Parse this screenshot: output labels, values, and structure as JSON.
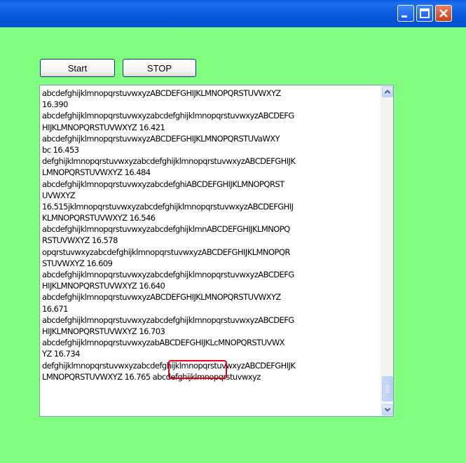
{
  "window": {
    "title_buttons": [
      "minimize-icon",
      "maximize-icon",
      "close-icon"
    ]
  },
  "toolbar": {
    "start_label": "Start",
    "stop_label": "STOP"
  },
  "log": {
    "lines": [
      "abcdefghijklmnopqrstuvwxyzABCDEFGHIJKLMNOPQRSTUVWXYZ",
      "16.390",
      "abcdefghijklmnopqrstuvwxyzabcdefghijklmnopqrstuvwxyzABCDEFG",
      "HIJKLMNOPQRSTUVWXYZ 16.421",
      "abcdefghijklmnopqrstuvwxyzABCDEFGHIJKLMNOPQRSTUVaWXY",
      "bc 16.453",
      "defghijklmnopqrstuvwxyzabcdefghijklmnopqrstuvwxyzABCDEFGHIJK",
      "LMNOPQRSTUVWXYZ 16.484",
      "abcdefghijklmnopqrstuvwxyzabcdefghiABCDEFGHIJKLMNOPQRST",
      "UVWXYZ",
      "16.515jklmnopqrstuvwxyzabcdefghijklmnopqrstuvwxyzABCDEFGHIJ",
      "KLMNOPQRSTUVWXYZ 16.546",
      "abcdefghijklmnopqrstuvwxyzabcdefghijklmnABCDEFGHIJKLMNOPQ",
      "RSTUVWXYZ 16.578",
      "opqrstuvwxyzabcdefghijklmnopqrstuvwxyzABCDEFGHIJKLMNOPQR",
      "STUVWXYZ 16.609",
      "abcdefghijklmnopqrstuvwxyzabcdefghijklmnopqrstuvwxyzABCDEFG",
      "HIJKLMNOPQRSTUVWXYZ 16.640",
      "abcdefghijklmnopqrstuvwxyzABCDEFGHIJKLMNOPQRSTUVWXYZ",
      "16.671",
      "abcdefghijklmnopqrstuvwxyzabcdefghijklmnopqrstuvwxyzABCDEFG",
      "HIJKLMNOPQRSTUVWXYZ 16.703",
      "abcdefghijklmnopqrstuvwxyzabABCDEFGHIJKLcMNOPQRSTUVWX",
      "YZ 16.734",
      "defghijklmnopqrstuvwxyzabcdefghijklmnopqrstuvwxyzABCDEFGHIJK",
      "LMNOPQRSTUVWXYZ 16.765 abcdefghijklmnopqrstuvwxyz"
    ]
  },
  "colors": {
    "background": "#80ff80",
    "titlebar": "#0a5de6",
    "highlight": "#e4001c"
  }
}
